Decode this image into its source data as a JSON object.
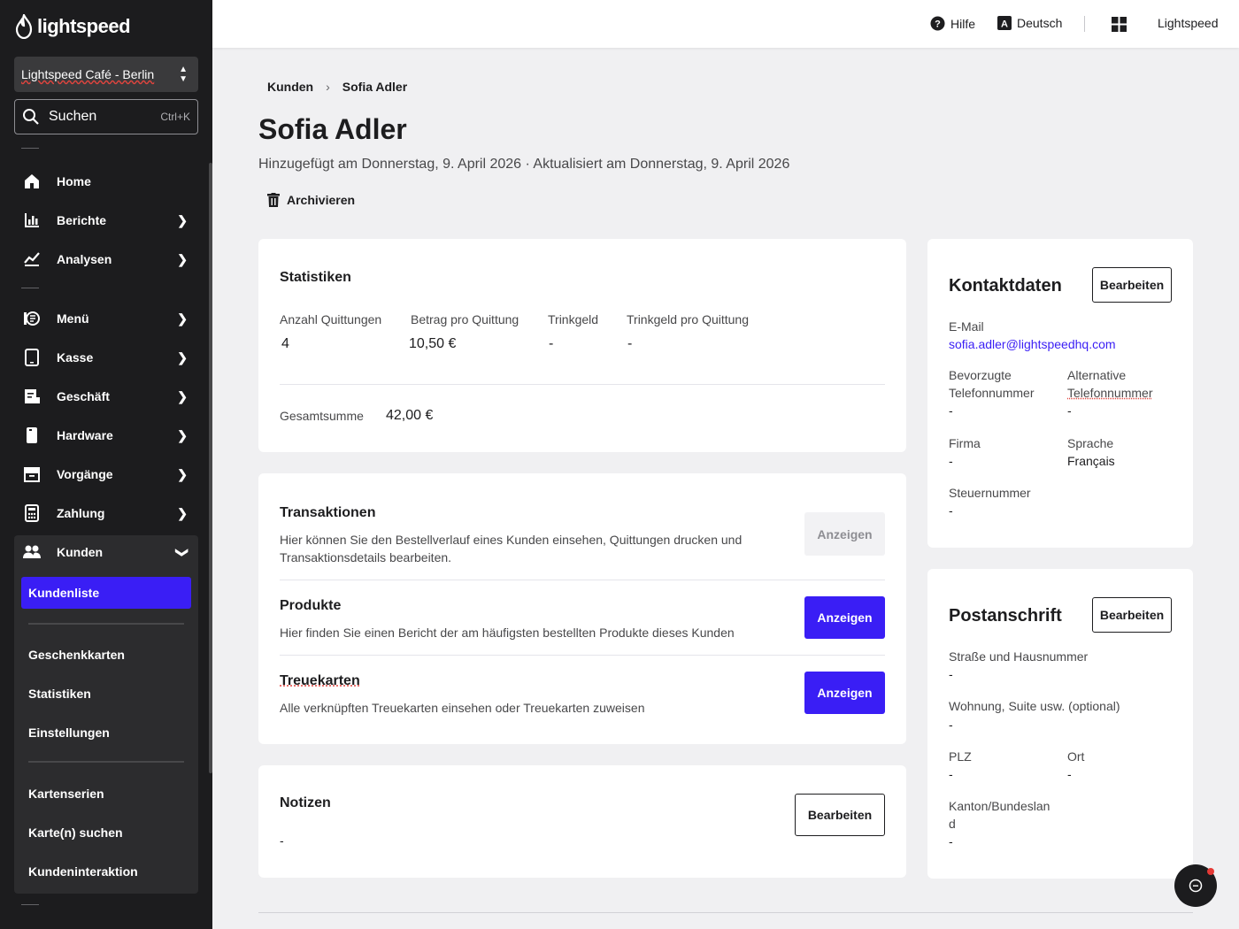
{
  "brand": {
    "logo_text": "lightspeed"
  },
  "sidebar": {
    "store": "Lightspeed Café - Berlin",
    "search_label": "Suchen",
    "search_shortcut": "Ctrl+K",
    "items": [
      {
        "label": "Home",
        "icon": "home-icon"
      },
      {
        "label": "Berichte",
        "icon": "bar-chart-icon"
      },
      {
        "label": "Analysen",
        "icon": "line-chart-icon"
      },
      {
        "label": "Menü",
        "icon": "menu-book-icon"
      },
      {
        "label": "Kasse",
        "icon": "tablet-icon"
      },
      {
        "label": "Geschäft",
        "icon": "store-icon"
      },
      {
        "label": "Hardware",
        "icon": "device-icon"
      },
      {
        "label": "Vorgänge",
        "icon": "archive-box-icon"
      },
      {
        "label": "Zahlung",
        "icon": "calculator-icon"
      },
      {
        "label": "Kunden",
        "icon": "people-icon"
      }
    ],
    "sub_items": [
      {
        "label": "Kundenliste"
      },
      {
        "label": "Geschenkkarten"
      },
      {
        "label": "Statistiken"
      },
      {
        "label": "Einstellungen"
      },
      {
        "label": "Kartenserien"
      },
      {
        "label": "Karte(n) suchen"
      },
      {
        "label": "Kundeninteraktion"
      }
    ]
  },
  "topbar": {
    "help": "Hilfe",
    "language": "Deutsch",
    "account": "Lightspeed"
  },
  "breadcrumb": {
    "parent": "Kunden",
    "current": "Sofia Adler"
  },
  "page": {
    "title": "Sofia Adler",
    "meta": "Hinzugefügt am Donnerstag, 9. April 2026 · Aktualisiert am Donnerstag, 9. April 2026",
    "archive": "Archivieren"
  },
  "stats": {
    "title": "Statistiken",
    "columns": [
      {
        "label": "Anzahl Quittungen",
        "value": "4"
      },
      {
        "label": "Betrag pro Quittung",
        "value": "10,50 €"
      },
      {
        "label": "Trinkgeld",
        "value": "-"
      },
      {
        "label": "Trinkgeld pro Quittung",
        "value": "-"
      }
    ],
    "total_label": "Gesamtsumme",
    "total_value": "42,00 €"
  },
  "sections": [
    {
      "title": "Transaktionen",
      "desc1": "Hier können Sie den Bestellverlauf eines Kunden einsehen, Quittungen drucken und",
      "desc2": "Transaktionsdetails bearbeiten.",
      "button": "Anzeigen",
      "enabled": false
    },
    {
      "title": "Produkte",
      "desc1": "Hier finden Sie einen Bericht der am häufigsten bestellten Produkte dieses Kunden",
      "button": "Anzeigen",
      "enabled": true
    },
    {
      "title": "Treuekarten",
      "desc1": "Alle verknüpften Treuekarten einsehen oder Treuekarten zuweisen",
      "button": "Anzeigen",
      "enabled": true
    }
  ],
  "notes": {
    "title": "Notizen",
    "value": "-",
    "button": "Bearbeiten"
  },
  "contact": {
    "title": "Kontaktdaten",
    "button": "Bearbeiten",
    "email_label": "E-Mail",
    "email": "sofia.adler@lightspeedhq.com",
    "phone_label_1": "Bevorzugte",
    "phone_label_2": "Telefonnummer",
    "phone": "-",
    "alt_phone_label_1": "Alternative",
    "alt_phone_label_2": "Telefonnummer",
    "alt_phone": "-",
    "company_label": "Firma",
    "company": "-",
    "language_label": "Sprache",
    "language": "Français",
    "tax_label": "Steuernummer",
    "tax": "-"
  },
  "address": {
    "title": "Postanschrift",
    "button": "Bearbeiten",
    "street_label": "Straße und Hausnummer",
    "street": "-",
    "apt_label": "Wohnung, Suite usw. (optional)",
    "apt": "-",
    "zip_label": "PLZ",
    "zip": "-",
    "city_label": "Ort",
    "city": "-",
    "state_label_1": "Kanton/Bundeslan",
    "state_label_2": "d",
    "state": "-"
  },
  "colors": {
    "accent": "#3a1ef5",
    "sidebar": "#1c1c1e"
  }
}
